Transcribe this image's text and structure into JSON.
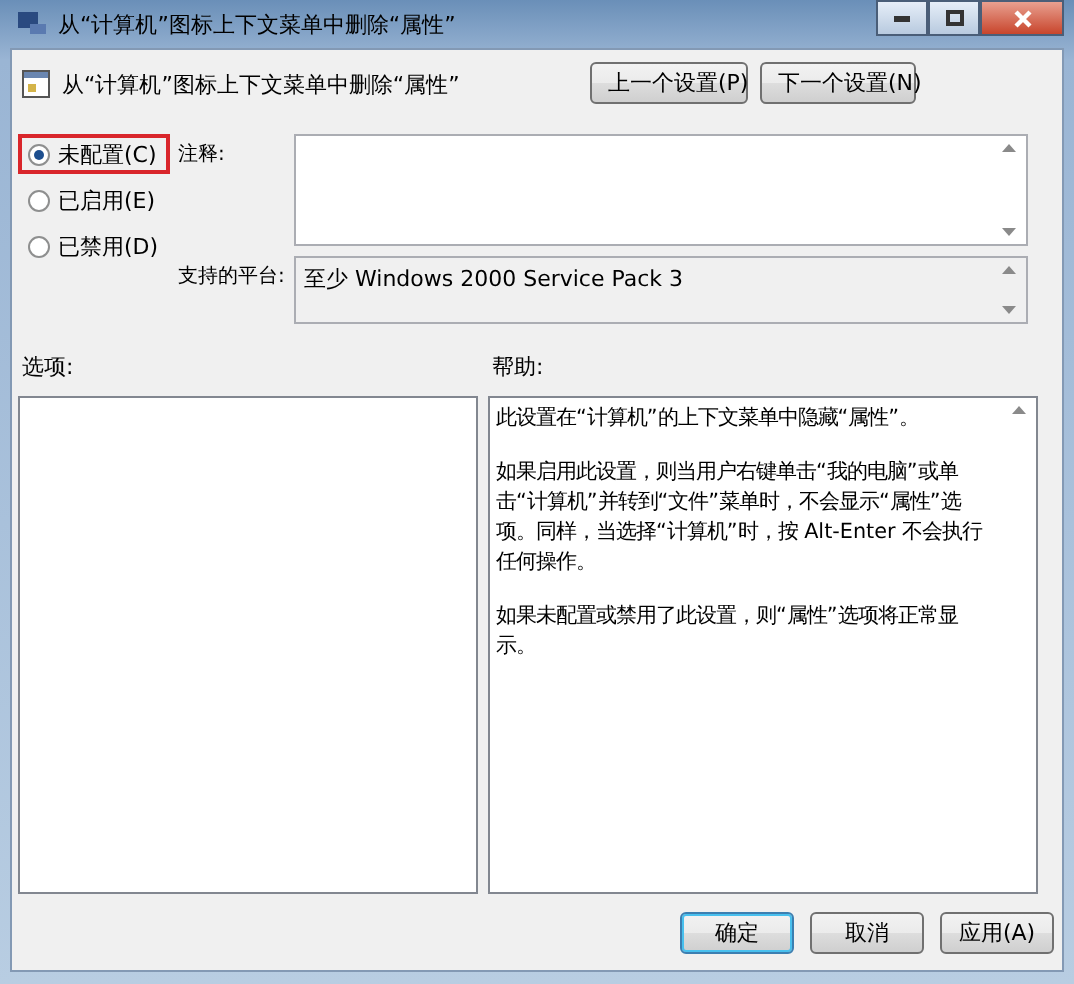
{
  "window": {
    "title": "从“计算机”图标上下文菜单中删除“属性”"
  },
  "header": {
    "title": "从“计算机”图标上下文菜单中删除“属性”",
    "buttons": [
      "上一个设置(P)",
      "下一个设置(N)"
    ]
  },
  "state_options": [
    {
      "label": "未配置(C)",
      "selected": true,
      "highlighted": true
    },
    {
      "label": "已启用(E)",
      "selected": false,
      "highlighted": false
    },
    {
      "label": "已禁用(D)",
      "selected": false,
      "highlighted": false
    }
  ],
  "comment": {
    "label": "注释:"
  },
  "platform": {
    "label": "支持的平台:",
    "value": "至少 Windows 2000 Service Pack 3"
  },
  "options": {
    "label": "选项:"
  },
  "help": {
    "label": "帮助:",
    "paragraphs": [
      "此设置在“计算机”的上下文菜单中隐藏“属性”。",
      "如果启用此设置，则当用户右键单击“我的电脑”或单击“计算机”并转到“文件”菜单时，不会显示“属性”选项。同样，当选择“计算机”时，按 Alt-Enter 不会执行任何操作。",
      "如果未配置或禁用了此设置，则“属性”选项将正常显示。"
    ]
  },
  "footer_buttons": [
    {
      "label": "确定",
      "default": true
    },
    {
      "label": "取消",
      "default": false
    },
    {
      "label": "应用(A)",
      "default": false
    }
  ]
}
